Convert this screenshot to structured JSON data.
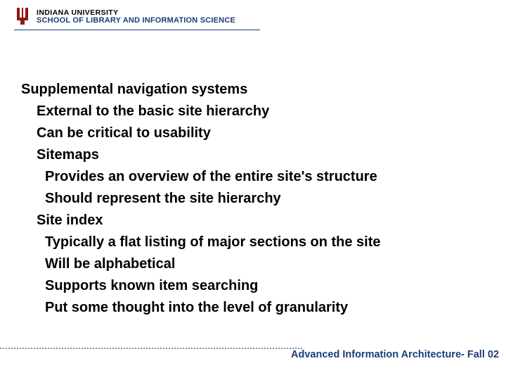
{
  "header": {
    "line1": "INDIANA UNIVERSITY",
    "line2": "SCHOOL OF LIBRARY AND INFORMATION SCIENCE"
  },
  "body": {
    "title": "Supplemental navigation systems",
    "items": [
      "External to the basic site hierarchy",
      "Can be critical to usability",
      "Sitemaps"
    ],
    "sitemaps": [
      "Provides an overview of the entire site's structure",
      "Should represent the site hierarchy"
    ],
    "siteindex_label": "Site index",
    "siteindex": [
      "Typically a flat listing of major sections on the site",
      "Will be alphabetical",
      "Supports known item searching",
      "Put some thought into the level of granularity"
    ]
  },
  "footer": "Advanced Information Architecture- Fall 02"
}
